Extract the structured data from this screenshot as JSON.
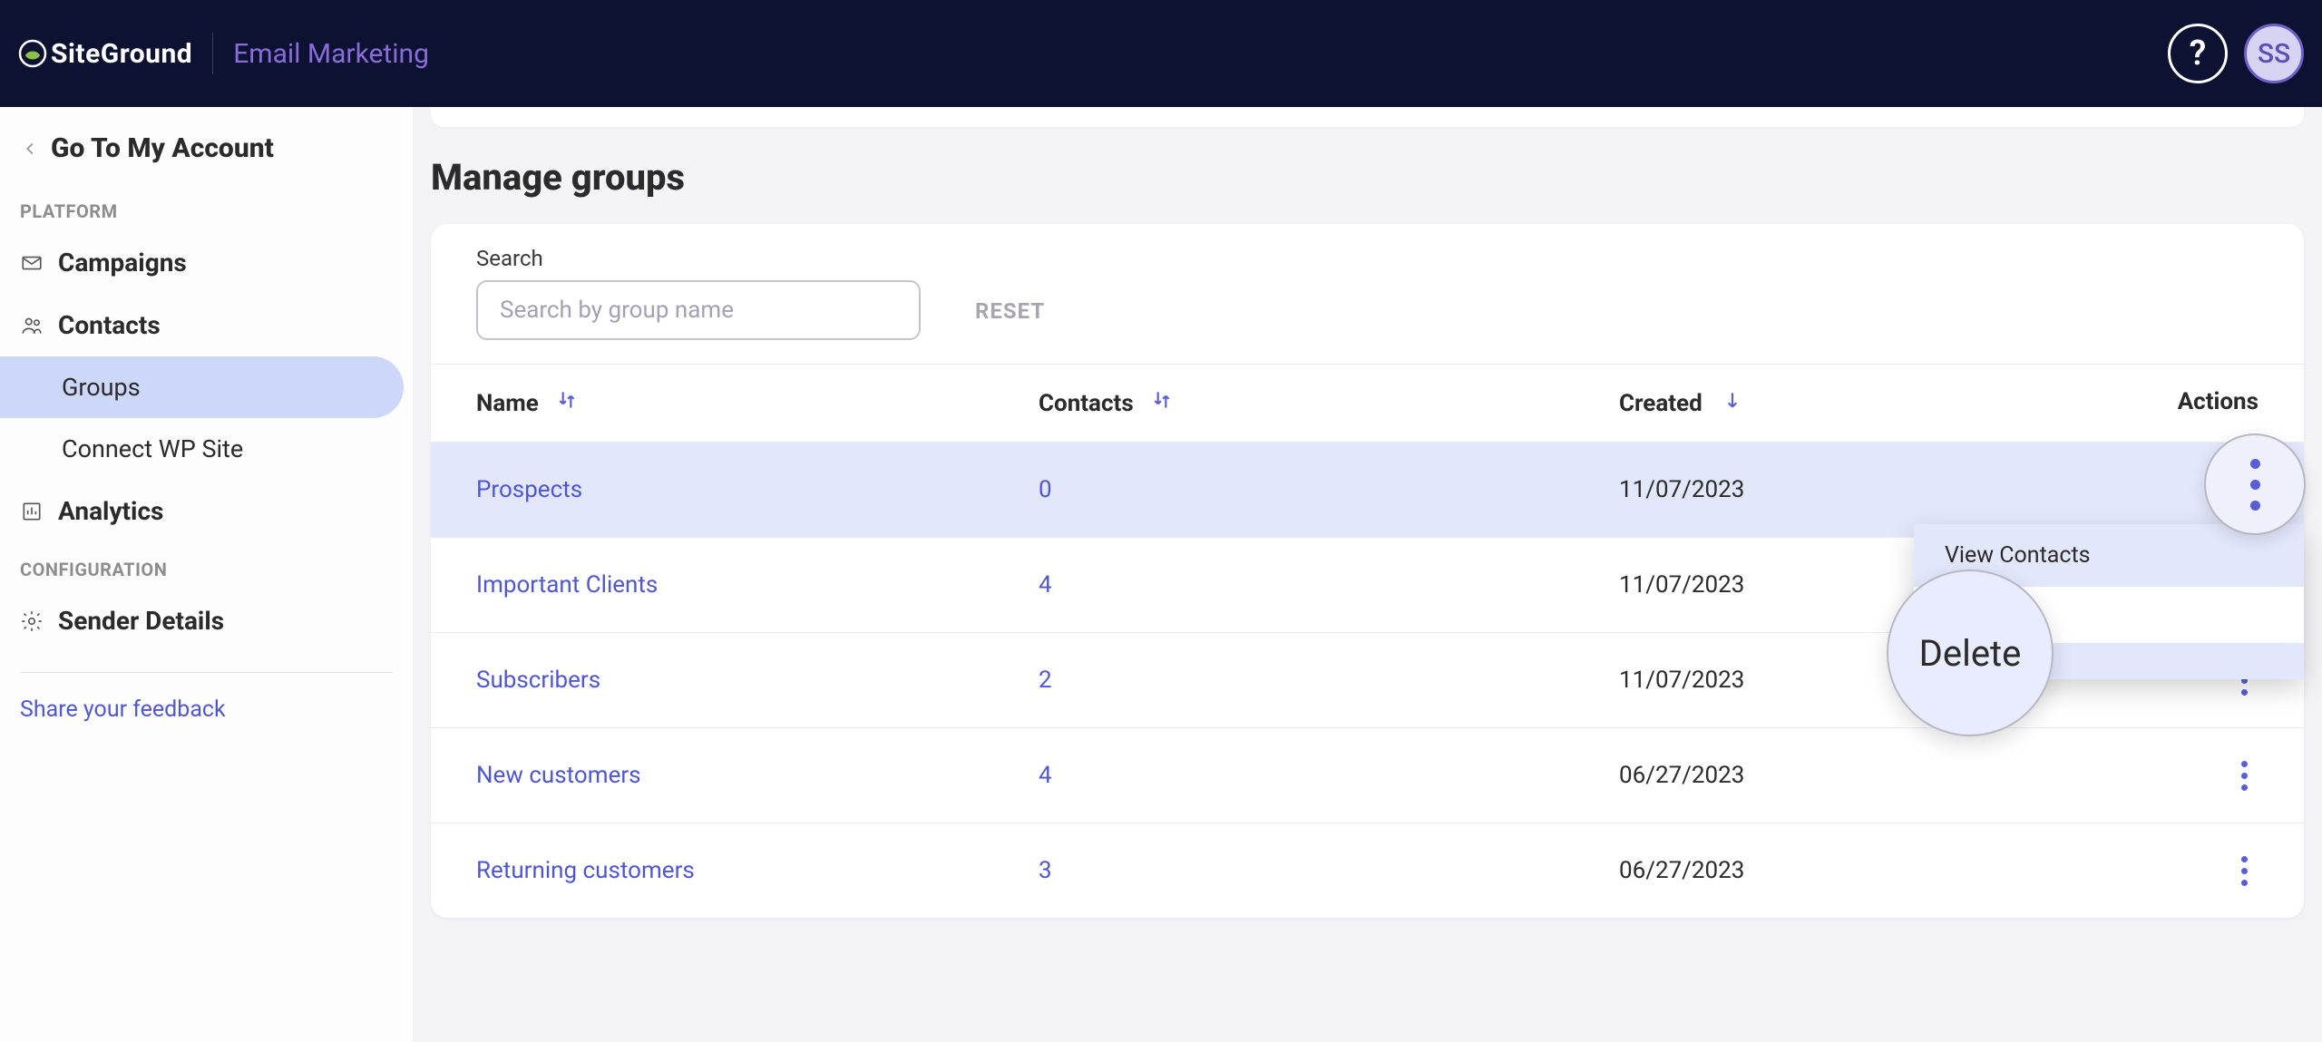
{
  "header": {
    "brand": "SiteGround",
    "product": "Email Marketing",
    "help_glyph": "?",
    "avatar_initials": "SS"
  },
  "sidebar": {
    "back_label": "Go To My Account",
    "section_platform": "PLATFORM",
    "section_config": "CONFIGURATION",
    "items": {
      "campaigns": "Campaigns",
      "contacts": "Contacts",
      "groups": "Groups",
      "connect_wp": "Connect WP Site",
      "analytics": "Analytics",
      "sender_details": "Sender Details"
    },
    "feedback": "Share your feedback"
  },
  "main": {
    "title": "Manage groups",
    "search_label": "Search",
    "search_placeholder": "Search by group name",
    "reset_label": "RESET",
    "columns": {
      "name": "Name",
      "contacts": "Contacts",
      "created": "Created",
      "actions": "Actions"
    },
    "rows": [
      {
        "name": "Prospects",
        "contacts": "0",
        "created": "11/07/2023"
      },
      {
        "name": "Important Clients",
        "contacts": "4",
        "created": "11/07/2023"
      },
      {
        "name": "Subscribers",
        "contacts": "2",
        "created": "11/07/2023"
      },
      {
        "name": "New customers",
        "contacts": "4",
        "created": "06/27/2023"
      },
      {
        "name": "Returning customers",
        "contacts": "3",
        "created": "06/27/2023"
      }
    ]
  },
  "dropdown": {
    "view_contacts": "View Contacts",
    "delete": "Delete"
  }
}
